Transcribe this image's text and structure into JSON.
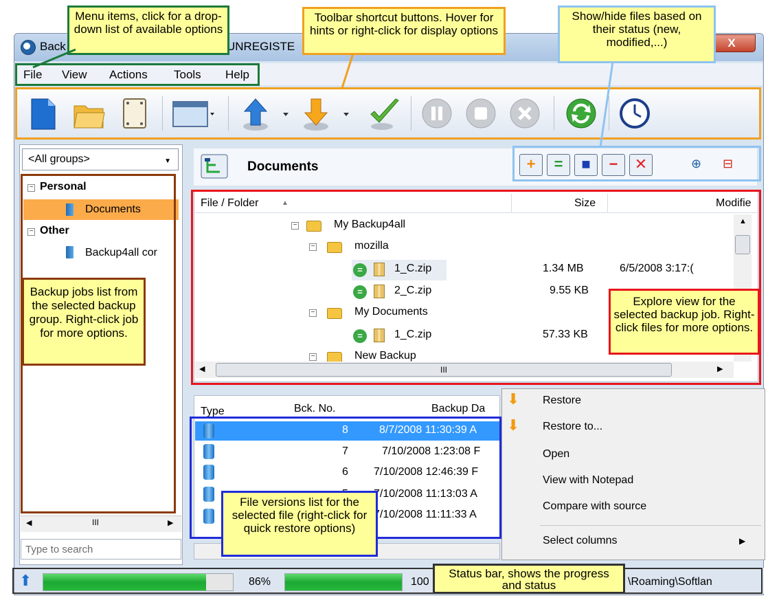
{
  "window": {
    "title_left": "Back",
    "title_right": "UNREGISTE",
    "close": "X"
  },
  "menu": [
    "File",
    "View",
    "Actions",
    "Tools",
    "Help"
  ],
  "toolbar_icons": [
    "new-icon",
    "open-icon",
    "properties-icon",
    "layout-icon",
    "backup-icon",
    "restore-icon",
    "test-icon",
    "pause-icon",
    "stop-icon",
    "cancel-icon",
    "refresh-icon",
    "scheduler-icon"
  ],
  "sidebar": {
    "group_select": "<All groups>",
    "groups": [
      {
        "name": "Personal",
        "jobs": [
          "Documents"
        ]
      },
      {
        "name": "Other",
        "jobs": [
          "Backup4all cor"
        ]
      }
    ],
    "search_placeholder": "Type to search",
    "scroll_marker": "III"
  },
  "explorer": {
    "title": "Documents",
    "columns": {
      "file": "File / Folder",
      "size": "Size",
      "modified": "Modifie"
    },
    "tree": [
      {
        "name": "My Backup4all",
        "type": "folder",
        "level": 0
      },
      {
        "name": "mozilla",
        "type": "folder",
        "level": 1
      },
      {
        "name": "1_C.zip",
        "type": "file",
        "level": 2,
        "size": "1.34 MB",
        "modified": "6/5/2008 3:17:("
      },
      {
        "name": "2_C.zip",
        "type": "file",
        "level": 2,
        "size": "9.55 KB",
        "modified": ""
      },
      {
        "name": "My Documents",
        "type": "folder",
        "level": 1
      },
      {
        "name": "1_C.zip",
        "type": "file",
        "level": 2,
        "size": "57.33 KB",
        "modified": ""
      },
      {
        "name": "New Backup",
        "type": "folder",
        "level": 1
      }
    ],
    "hscroll_marker": "III"
  },
  "versions": {
    "columns": {
      "type": "Type",
      "number": "Bck. No.",
      "date": "Backup Da"
    },
    "rows": [
      {
        "number": "8",
        "date": "8/7/2008 11:30:39 A"
      },
      {
        "number": "7",
        "date": "7/10/2008 1:23:08 F"
      },
      {
        "number": "6",
        "date": "7/10/2008 12:46:39 F"
      },
      {
        "number": "5",
        "date": "7/10/2008 11:13:03 A"
      },
      {
        "number": "",
        "date": "7/10/2008 11:11:33 A"
      }
    ]
  },
  "context_menu": [
    "Restore",
    "Restore to...",
    "Open",
    "View with Notepad",
    "Compare with source",
    "Select columns"
  ],
  "status": {
    "progress1_pct": 86,
    "progress1_label": "86%",
    "progress2_pct": 100,
    "progress2_label": "100",
    "path_text": "\\Roaming\\Softlan"
  },
  "callouts": {
    "menu": "Menu items, click for a drop-down list of available options",
    "toolbar": "Toolbar shortcut buttons. Hover for hints or right-click for display options",
    "filters": "Show/hide files based on their status (new, modified,...)",
    "jobs": "Backup jobs list from the selected backup group. Right-click job for more options.",
    "explore": "Explore view for the selected backup job. Right-click files for more options.",
    "versions": "File versions list for the selected file (right-click for quick restore options)",
    "statusbar": "Status bar, shows the progress and status"
  },
  "colors": {
    "menu_outline": "#1b7a3a",
    "toolbar_outline": "#f0a020",
    "filter_outline": "#8fc3f0",
    "jobs_outline": "#8b3a0a",
    "explore_outline": "#e8141b",
    "versions_outline": "#1f2bd8",
    "status_outline": "#333333",
    "callout_bg": "#ffff99",
    "selection": "#3399ff"
  }
}
